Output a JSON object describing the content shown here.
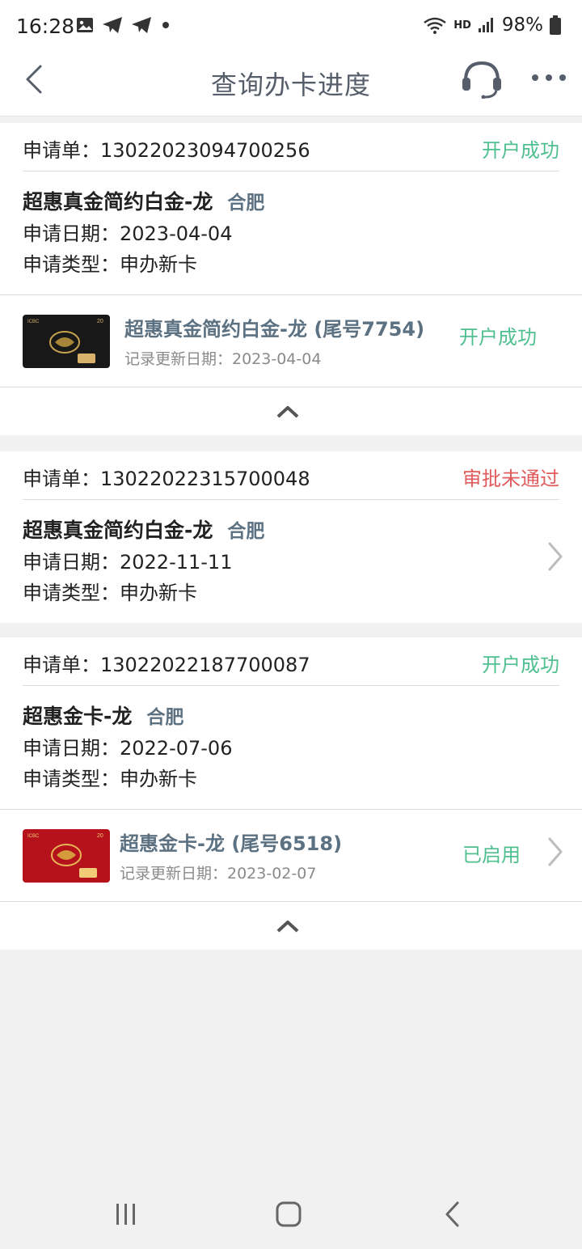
{
  "status_bar": {
    "time": "16:28",
    "network": "HD",
    "battery": "98%"
  },
  "header": {
    "title": "查询办卡进度"
  },
  "applications": [
    {
      "label": "申请单：",
      "number": "13022023094700256",
      "status": "开户成功",
      "product": "超惠真金简约白金-龙",
      "city": "合肥",
      "date_line": "申请日期：2023-04-04",
      "type_line": "申请类型：申办新卡",
      "card": {
        "title": "超惠真金简约白金-龙 (尾号7754)",
        "update": "记录更新日期：2023-04-04",
        "status": "开户成功"
      }
    },
    {
      "label": "申请单：",
      "number": "13022022315700048",
      "status": "审批未通过",
      "product": "超惠真金简约白金-龙",
      "city": "合肥",
      "date_line": "申请日期：2022-11-11",
      "type_line": "申请类型：申办新卡"
    },
    {
      "label": "申请单：",
      "number": "13022022187700087",
      "status": "开户成功",
      "product": "超惠金卡-龙",
      "city": "合肥",
      "date_line": "申请日期：2022-07-06",
      "type_line": "申请类型：申办新卡",
      "card": {
        "title": "超惠金卡-龙 (尾号6518)",
        "update": "记录更新日期：2023-02-07",
        "status": "已启用"
      }
    }
  ],
  "colors": {
    "success": "#4fbf8f",
    "rejected": "#e25b5b",
    "accent_text": "#5c7181"
  }
}
